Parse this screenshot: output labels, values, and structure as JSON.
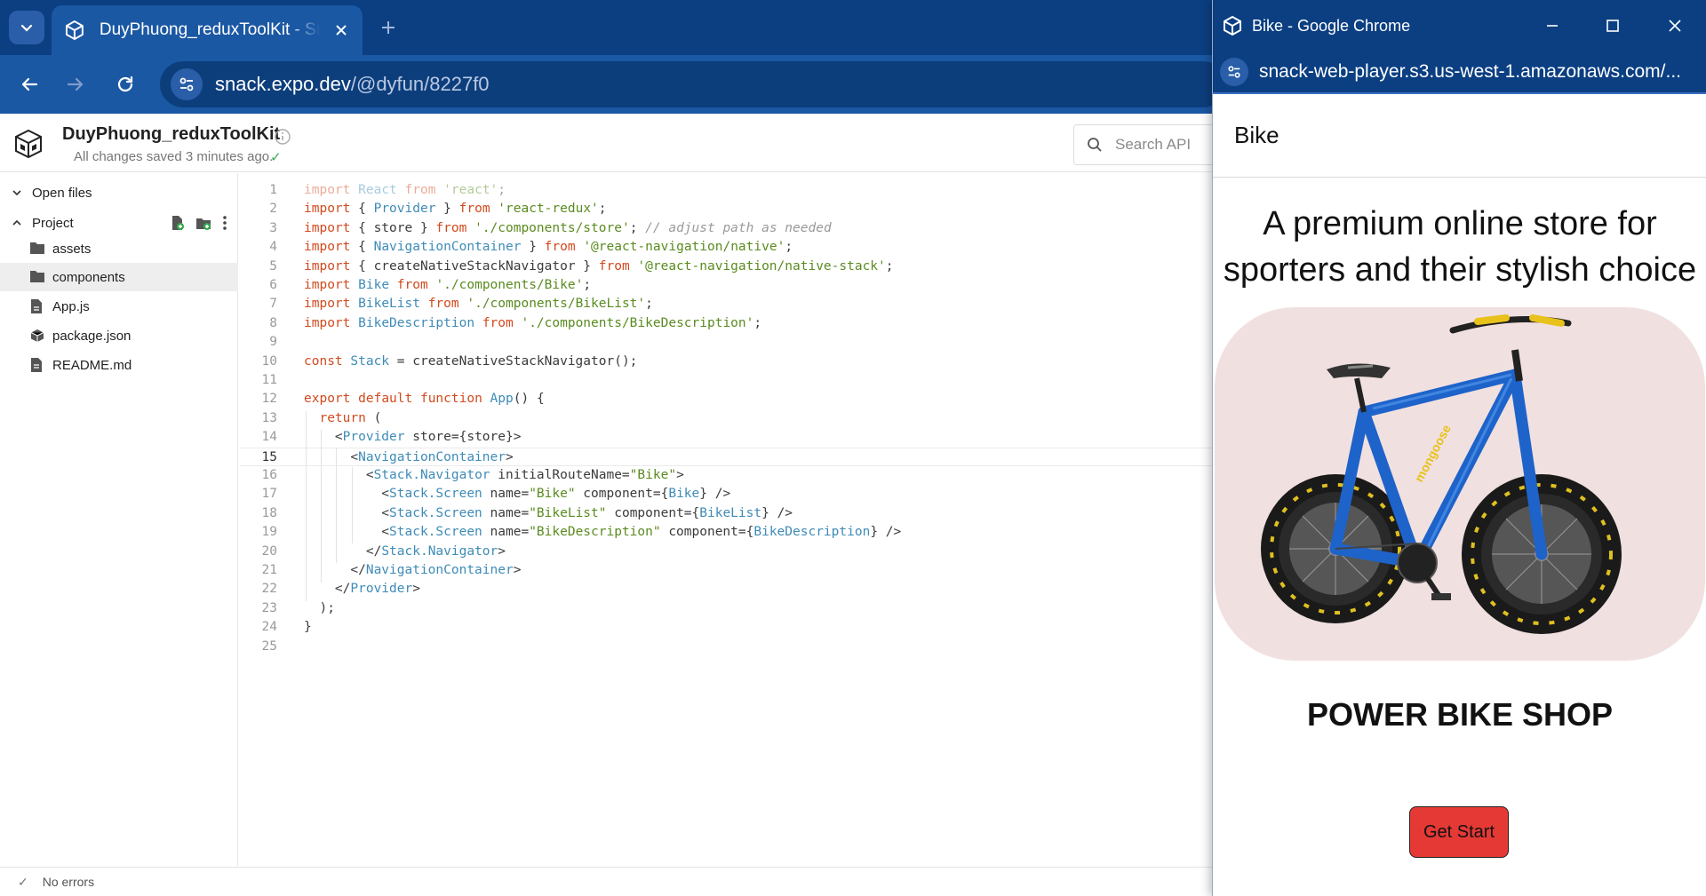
{
  "browser": {
    "tab_title": "DuyPhuong_reduxToolKit - Snack",
    "url_host": "snack.expo.dev",
    "url_path": "/@dyfun/8227f0"
  },
  "snack": {
    "project_title": "DuyPhuong_reduxToolKit",
    "save_status": "All changes saved 3 minutes ago.",
    "search_placeholder": "Search API"
  },
  "sidebar": {
    "open_files_label": "Open files",
    "project_label": "Project",
    "files": [
      {
        "name": "assets",
        "type": "folder"
      },
      {
        "name": "components",
        "type": "folder",
        "selected": true
      },
      {
        "name": "App.js",
        "type": "js"
      },
      {
        "name": "package.json",
        "type": "package"
      },
      {
        "name": "README.md",
        "type": "md"
      }
    ]
  },
  "editor": {
    "current_line": 15,
    "lines": [
      "import React from 'react';",
      "import { Provider } from 'react-redux';",
      "import { store } from './components/store'; // adjust path as needed",
      "import { NavigationContainer } from '@react-navigation/native';",
      "import { createNativeStackNavigator } from '@react-navigation/native-stack';",
      "import Bike from './components/Bike';",
      "import BikeList from './components/BikeList';",
      "import BikeDescription from './components/BikeDescription';",
      "",
      "const Stack = createNativeStackNavigator();",
      "",
      "export default function App() {",
      "  return (",
      "    <Provider store={store}>",
      "      <NavigationContainer>",
      "        <Stack.Navigator initialRouteName=\"Bike\">",
      "          <Stack.Screen name=\"Bike\" component={Bike} />",
      "          <Stack.Screen name=\"BikeList\" component={BikeList} />",
      "          <Stack.Screen name=\"BikeDescription\" component={BikeDescription} />",
      "        </Stack.Navigator>",
      "      </NavigationContainer>",
      "    </Provider>",
      "  );",
      "}",
      ""
    ]
  },
  "statusbar": {
    "text": "No errors"
  },
  "popup": {
    "window_title": "Bike - Google Chrome",
    "url": "snack-web-player.s3.us-west-1.amazonaws.com/...",
    "app_header": "Bike",
    "tagline": "A premium online store for sporters and their stylish choice",
    "shop_name": "POWER BIKE SHOP",
    "button_label": "Get Start"
  },
  "colors": {
    "chrome_dark": "#0b3f82",
    "chrome_toolbar": "#1b58a4",
    "keyword": "#d24a1e",
    "string": "#5a8b1f",
    "identifier": "#3e8bb7",
    "card_bg": "#f1e0e0",
    "button_red": "#e53935"
  }
}
